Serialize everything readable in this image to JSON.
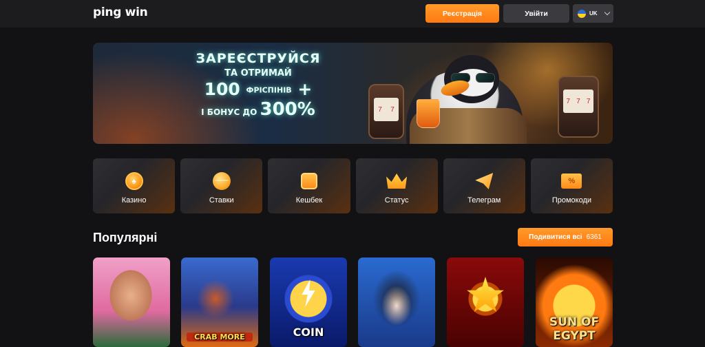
{
  "header": {
    "logo": "ping win",
    "register_label": "Реєстрація",
    "login_label": "Увійти",
    "language": "UK"
  },
  "banner": {
    "line1": "ЗАРЕЄСТРУЙСЯ",
    "line2": "ТА ОТРИМАЙ",
    "line3_number": "100",
    "line3_word": "ФРІСПІНІВ",
    "line3_plus": "+",
    "line4_text": "І БОНУС ДО",
    "line4_percent": "300%"
  },
  "categories": [
    {
      "label": "Казино",
      "icon": "casino-chip-icon"
    },
    {
      "label": "Ставки",
      "icon": "sports-ball-icon"
    },
    {
      "label": "Кешбек",
      "icon": "cashback-bag-icon"
    },
    {
      "label": "Статус",
      "icon": "crown-icon"
    },
    {
      "label": "Телеграм",
      "icon": "telegram-icon"
    },
    {
      "label": "Промокоди",
      "icon": "promo-ticket-icon"
    }
  ],
  "popular": {
    "title": "Популярні",
    "view_all_label": "Подивитися всі",
    "view_all_count": "6361"
  },
  "games": [
    {
      "label": ""
    },
    {
      "label": "CRAB MORE"
    },
    {
      "label": "COIN"
    },
    {
      "label": ""
    },
    {
      "label": ""
    },
    {
      "label": "SUN OF EGYPT"
    }
  ],
  "colors": {
    "accent": "#ff8a1f",
    "background": "#121214",
    "header": "#1c1c1f"
  }
}
